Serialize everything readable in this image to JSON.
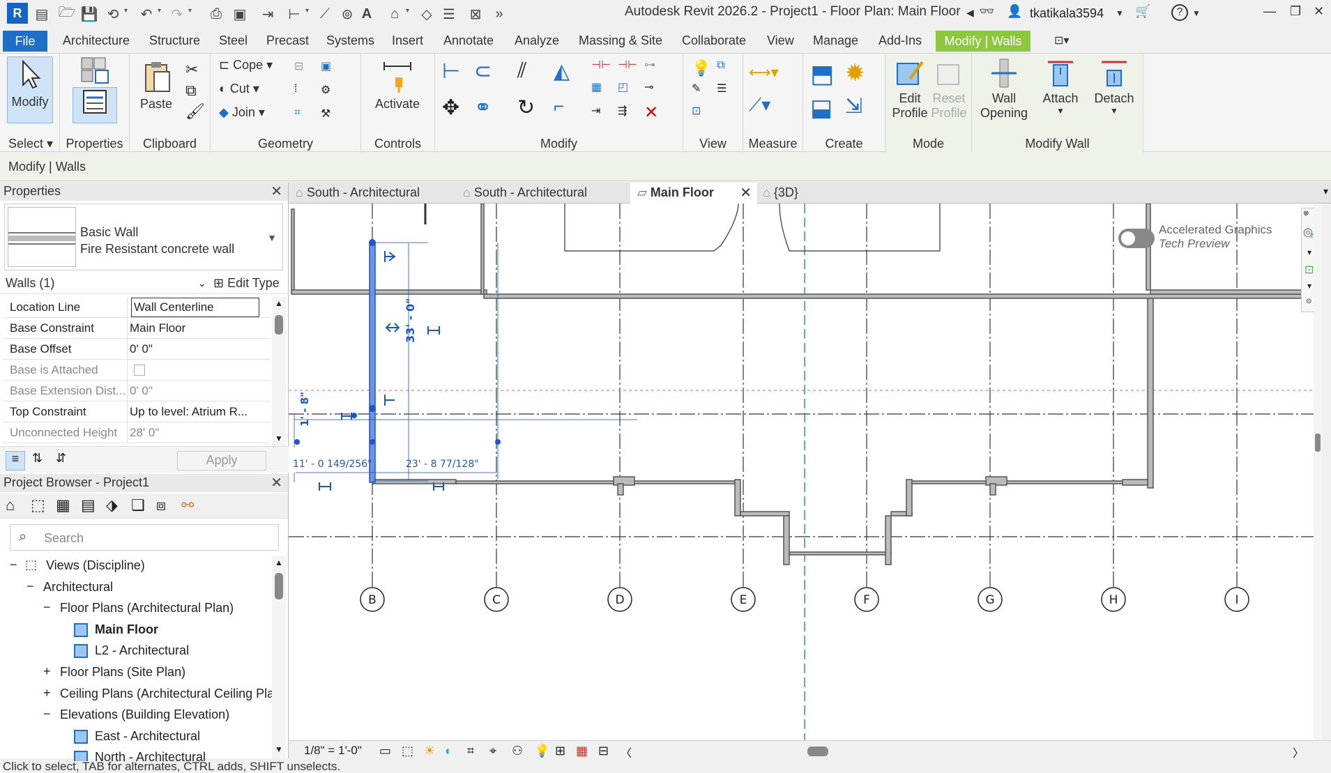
{
  "title_bar": {
    "title": "Autodesk Revit 2026.2 - Project1 - Floor Plan: Main Floor",
    "app_logo": "R",
    "username": "tkatikala3594",
    "help": "?",
    "icons": [
      "open-icon",
      "save-icon",
      "sync-icon",
      "undo-icon",
      "redo-icon",
      "print-icon",
      "measure-icon",
      "dimension-icon",
      "text-icon",
      "home-icon",
      "binoculars-icon",
      "user-icon",
      "cart-icon",
      "help-icon",
      "minimize-icon",
      "restore-icon",
      "close-icon"
    ]
  },
  "ribbon_tabs": {
    "file": "File",
    "tabs": [
      "Architecture",
      "Structure",
      "Steel",
      "Precast",
      "Systems",
      "Insert",
      "Annotate",
      "Analyze",
      "Massing & Site",
      "Collaborate",
      "View",
      "Manage",
      "Add-Ins"
    ],
    "contextual": "Modify | Walls"
  },
  "ribbon": {
    "modify_label": "Modify",
    "select_panel": "Select",
    "properties_panel": "Properties",
    "clipboard_panel": "Clipboard",
    "paste_label": "Paste",
    "geometry_panel": "Geometry",
    "cope_label": "Cope",
    "cut_label": "Cut",
    "join_label": "Join",
    "controls_panel": "Controls",
    "activate_label": "Activate",
    "modify_panel": "Modify",
    "view_panel": "View",
    "measure_panel": "Measure",
    "create_panel": "Create",
    "mode_panel": "Mode",
    "edit_profile_1": "Edit",
    "edit_profile_2": "Profile",
    "reset_profile_1": "Reset",
    "reset_profile_2": "Profile",
    "modify_wall_panel": "Modify Wall",
    "wall_opening_1": "Wall",
    "wall_opening_2": "Opening",
    "attach_label": "Attach",
    "detach_label": "Detach"
  },
  "context_bar": {
    "label": "Modify | Walls"
  },
  "properties": {
    "header": "Properties",
    "type_family": "Basic Wall",
    "type_name": "Fire  Resistant concrete wall",
    "instance_filter": "Walls (1)",
    "edit_type": "Edit Type",
    "apply": "Apply",
    "rows": [
      {
        "name": "Location Line",
        "value": "Wall Centerline",
        "dim": false
      },
      {
        "name": "Base Constraint",
        "value": "Main Floor",
        "dim": false
      },
      {
        "name": "Base Offset",
        "value": "0'  0\"",
        "dim": false
      },
      {
        "name": "Base is Attached",
        "value": "",
        "dim": true
      },
      {
        "name": "Base Extension Dist...",
        "value": "0'  0\"",
        "dim": true
      },
      {
        "name": "Top Constraint",
        "value": "Up to level: Atrium R...",
        "dim": false
      },
      {
        "name": "Unconnected Height",
        "value": "28'  0\"",
        "dim": true
      }
    ]
  },
  "browser": {
    "header": "Project Browser - Project1",
    "search_placeholder": "Search",
    "tree": [
      {
        "label": "Views (Discipline)",
        "level": 0,
        "expander": "−",
        "bold": false,
        "view": false
      },
      {
        "label": "Architectural",
        "level": 1,
        "expander": "−",
        "bold": false,
        "view": false
      },
      {
        "label": "Floor Plans (Architectural Plan)",
        "level": 2,
        "expander": "−",
        "bold": false,
        "view": false
      },
      {
        "label": "Main Floor",
        "level": 3,
        "expander": "",
        "bold": true,
        "view": true
      },
      {
        "label": "L2 - Architectural",
        "level": 3,
        "expander": "",
        "bold": false,
        "view": true
      },
      {
        "label": "Floor Plans (Site Plan)",
        "level": 2,
        "expander": "+",
        "bold": false,
        "view": false
      },
      {
        "label": "Ceiling Plans (Architectural Ceiling Pla",
        "level": 2,
        "expander": "+",
        "bold": false,
        "view": false
      },
      {
        "label": "Elevations (Building Elevation)",
        "level": 2,
        "expander": "−",
        "bold": false,
        "view": false
      },
      {
        "label": "East - Architectural",
        "level": 3,
        "expander": "",
        "bold": false,
        "view": true
      },
      {
        "label": "North - Architectural",
        "level": 3,
        "expander": "",
        "bold": false,
        "view": true
      }
    ]
  },
  "view_tabs": [
    {
      "label": "South - Architectural",
      "active": false
    },
    {
      "label": "South - Architectural",
      "active": false
    },
    {
      "label": "Main Floor",
      "active": true
    },
    {
      "label": "{3D}",
      "active": false
    }
  ],
  "canvas": {
    "grid_labels": [
      "B",
      "C",
      "D",
      "E",
      "F",
      "G",
      "H",
      "I"
    ],
    "dim_vertical": "33' - 0\"",
    "dim_small": "1' - 8\"",
    "dim_left": "11' - 0 149/256\"",
    "dim_right": "23' - 8 77/128\"",
    "ag_label1": "Accelerated Graphics",
    "ag_label2": "Tech Preview",
    "nav_2d": "2D",
    "selection_color": "#1e56c8"
  },
  "view_control": {
    "scale": "1/8\" = 1'-0\""
  },
  "status": {
    "text": "Click to select, TAB for alternates, CTRL adds, SHIFT unselects."
  }
}
